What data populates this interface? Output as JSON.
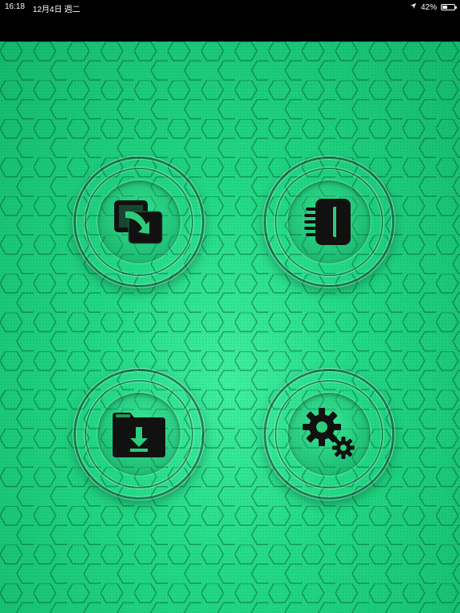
{
  "status_bar": {
    "time": "16:18",
    "date": "12月4日 週二",
    "battery_percent_label": "42%",
    "battery_level": 0.42
  },
  "colors": {
    "background_light": "#3ff0a0",
    "background_dark": "#14b86c",
    "icon": "#111111",
    "icon_accent": "#2ecc7a"
  },
  "tiles": [
    {
      "icon": "copy-transfer-icon"
    },
    {
      "icon": "notebook-icon"
    },
    {
      "icon": "folder-download-icon"
    },
    {
      "icon": "settings-gears-icon"
    }
  ]
}
